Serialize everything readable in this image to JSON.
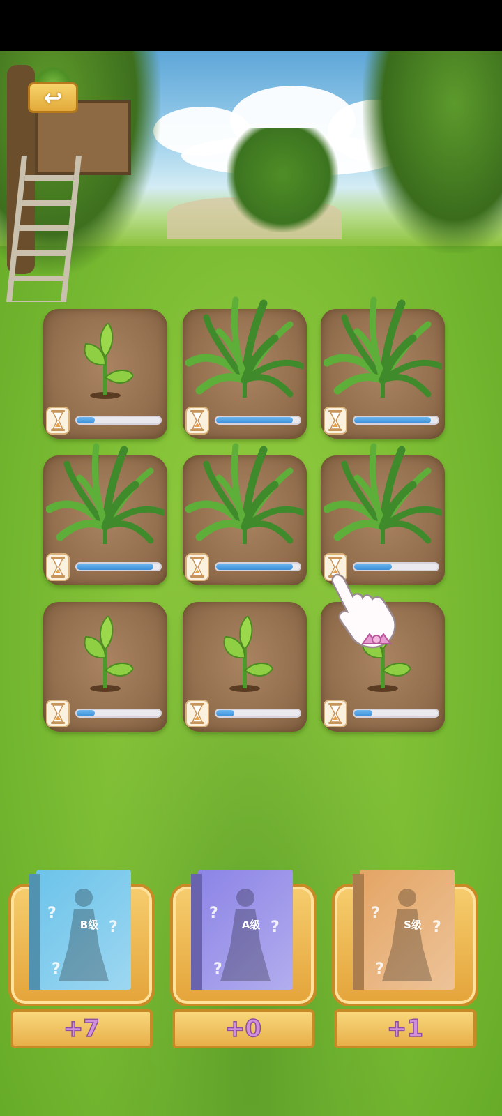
{
  "header": {
    "back_icon_glyph": "↩"
  },
  "plots": [
    {
      "stage": "sprout",
      "progress": 0.22
    },
    {
      "stage": "grass",
      "progress": 0.92
    },
    {
      "stage": "grass",
      "progress": 0.92
    },
    {
      "stage": "grass",
      "progress": 0.92
    },
    {
      "stage": "grass",
      "progress": 0.92
    },
    {
      "stage": "grass",
      "progress": 0.45
    },
    {
      "stage": "sprout",
      "progress": 0.22
    },
    {
      "stage": "sprout",
      "progress": 0.22
    },
    {
      "stage": "sprout",
      "progress": 0.22
    }
  ],
  "reward_boxes": [
    {
      "grade": "B级",
      "count": "+7",
      "color": "#6cc3ea"
    },
    {
      "grade": "A级",
      "count": "+0",
      "color": "#8c84e6"
    },
    {
      "grade": "S级",
      "count": "+1",
      "color": "#e4a565"
    }
  ],
  "colors": {
    "progress_fill": "#3a8fd8",
    "soil": "#94704f",
    "grass_bg": "#7cbd34"
  },
  "icons": [
    "back-arrow-icon",
    "hourglass-icon",
    "pointer-hand-icon",
    "question-mark-icon"
  ]
}
